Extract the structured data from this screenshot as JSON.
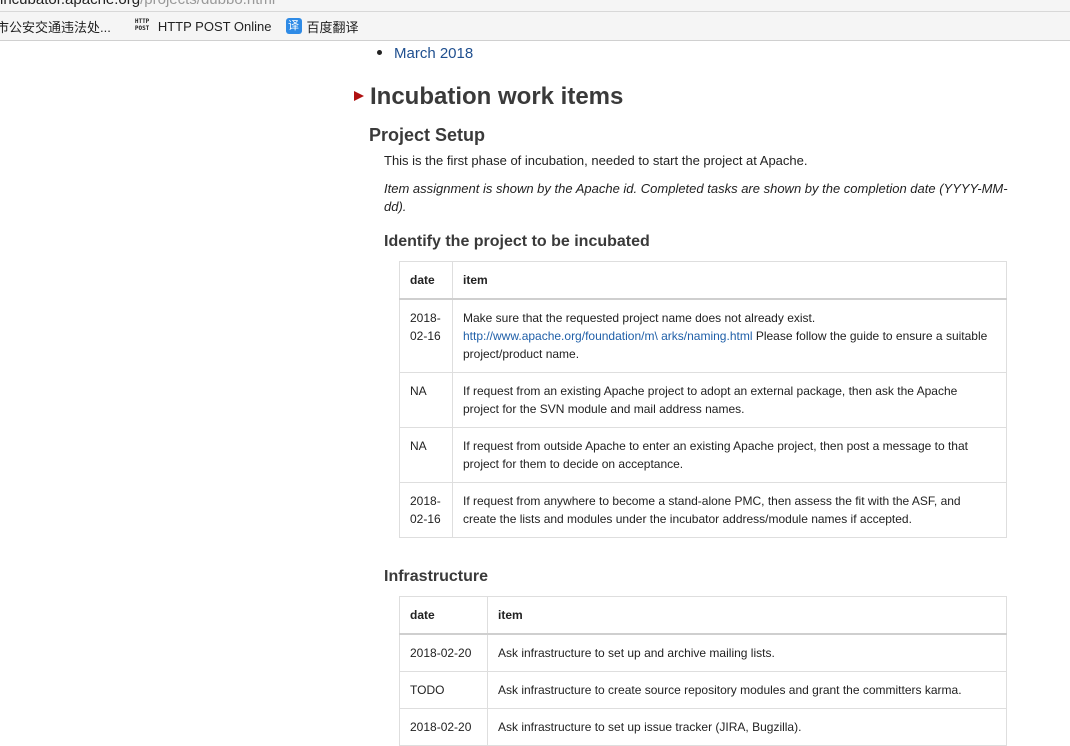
{
  "browser": {
    "url_host": "incubator.apache.org",
    "url_path": "/projects/dubbo.html",
    "bookmarks": [
      {
        "label": "市公安交通违法处...",
        "icon": "none"
      },
      {
        "label": "HTTP POST Online",
        "icon": "http-post-icon",
        "icon_text": "HTTP POST"
      },
      {
        "label": "百度翻译",
        "icon": "baidu-translate-icon",
        "icon_text": "译"
      }
    ]
  },
  "page": {
    "list_item": "March 2018",
    "section_title": "Incubation work items",
    "subsection_title": "Project Setup",
    "intro": "This is the first phase of incubation, needed to start the project at Apache.",
    "note": "Item assignment is shown by the Apache id. Completed tasks are shown by the completion date (YYYY-MM-dd).",
    "identify": {
      "heading": "Identify the project to be incubated",
      "col_date": "date",
      "col_item": "item",
      "rows": [
        {
          "date": "2018-02-16",
          "text_before": "Make sure that the requested project name does not already exist.",
          "link": "http://www.apache.org/foundation/m\\ arks/naming.html",
          "text_after": " Please follow the guide to ensure a suitable project/product name."
        },
        {
          "date": "NA",
          "text": "If request from an existing Apache project to adopt an external package, then ask the Apache project for the SVN module and mail address names."
        },
        {
          "date": "NA",
          "text": "If request from outside Apache to enter an existing Apache project, then post a message to that project for them to decide on acceptance."
        },
        {
          "date": "2018-02-16",
          "text": "If request from anywhere to become a stand-alone PMC, then assess the fit with the ASF, and create the lists and modules under the incubator address/module names if accepted."
        }
      ]
    },
    "infrastructure": {
      "heading": "Infrastructure",
      "col_date": "date",
      "col_item": "item",
      "rows": [
        {
          "date": "2018-02-20",
          "text": "Ask infrastructure to set up and archive mailing lists."
        },
        {
          "date": "TODO",
          "text": "Ask infrastructure to create source repository modules and grant the committers karma."
        },
        {
          "date": "2018-02-20",
          "text": "Ask infrastructure to set up issue tracker (JIRA, Bugzilla)."
        }
      ]
    }
  }
}
